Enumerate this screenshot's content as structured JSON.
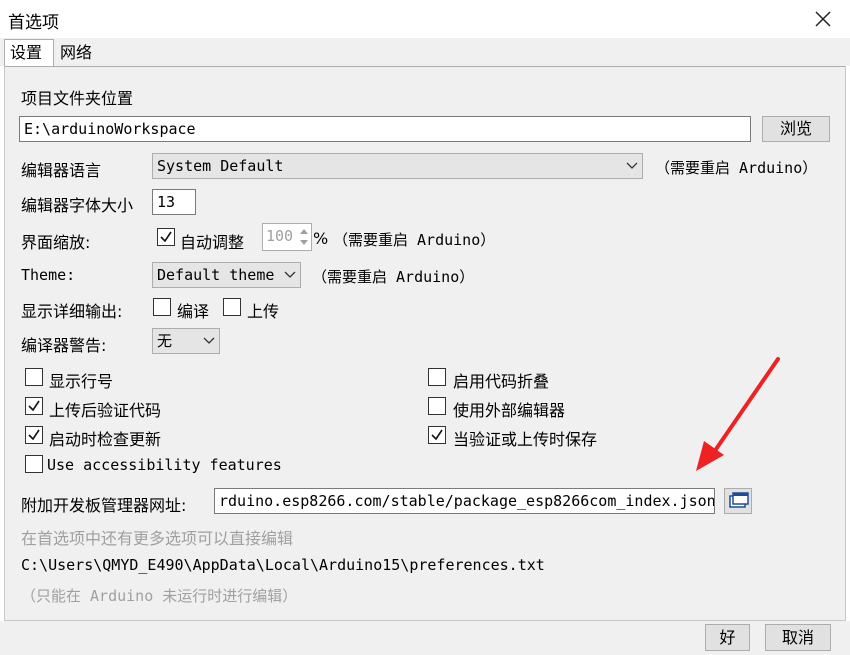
{
  "window": {
    "title": "首选项"
  },
  "tabs": [
    {
      "label": "设置",
      "active": true
    },
    {
      "label": "网络",
      "active": false
    }
  ],
  "sketchbook": {
    "label": "项目文件夹位置",
    "path": "E:\\arduinoWorkspace",
    "browse_label": "浏览"
  },
  "editor_language": {
    "label": "编辑器语言",
    "value": "System Default",
    "note": "（需要重启 Arduino）"
  },
  "font_size": {
    "label": "编辑器字体大小",
    "value": "13"
  },
  "interface_scale": {
    "label": "界面缩放:",
    "auto_label": "自动调整",
    "auto_checked": true,
    "value": "100",
    "unit": "%",
    "note": "（需要重启 Arduino）"
  },
  "theme": {
    "label": "Theme:",
    "value": "Default theme",
    "note": "（需要重启 Arduino）"
  },
  "verbose_output": {
    "label": "显示详细输出:",
    "compile_label": "编译",
    "compile_checked": false,
    "upload_label": "上传",
    "upload_checked": false
  },
  "compiler_warnings": {
    "label": "编译器警告:",
    "value": "无"
  },
  "options": {
    "left": [
      {
        "label": "显示行号",
        "checked": false
      },
      {
        "label": "上传后验证代码",
        "checked": true
      },
      {
        "label": "启动时检查更新",
        "checked": true
      },
      {
        "label": "Use accessibility features",
        "checked": false
      }
    ],
    "right": [
      {
        "label": "启用代码折叠",
        "checked": false
      },
      {
        "label": "使用外部编辑器",
        "checked": false
      },
      {
        "label": "当验证或上传时保存",
        "checked": true
      }
    ]
  },
  "board_manager": {
    "label": "附加开发板管理器网址:",
    "url": "rduino.esp8266.com/stable/package_esp8266com_index.json"
  },
  "more_prefs_hint": "在首选项中还有更多选项可以直接编辑",
  "prefs_path": "C:\\Users\\QMYD_E490\\AppData\\Local\\Arduino15\\preferences.txt",
  "edit_hint": "（只能在 Arduino 未运行时进行编辑）",
  "buttons": {
    "ok": "好",
    "cancel": "取消"
  },
  "colors": {
    "annotation_arrow": "#ee2222",
    "panel_bg": "#f0f0f0"
  },
  "icons": {
    "close": "close-icon",
    "dropdown": "chevron-down-icon",
    "window_button": "window-icon",
    "check": "check-icon"
  }
}
